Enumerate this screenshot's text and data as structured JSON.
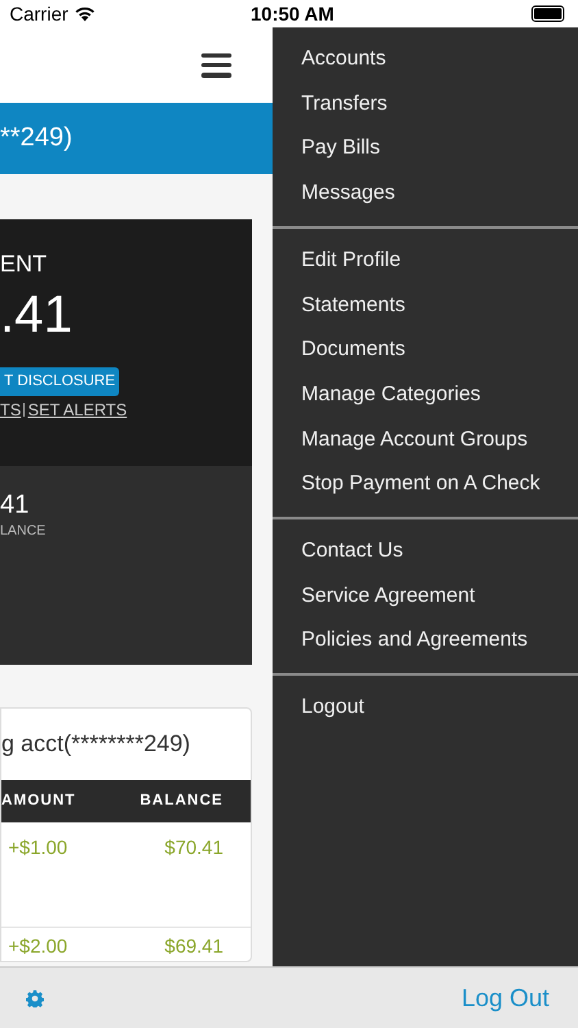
{
  "status_bar": {
    "carrier": "Carrier",
    "time": "10:50 AM"
  },
  "account_bar": {
    "title": "**249)"
  },
  "summary_card": {
    "label": "ENT",
    "amount": ".41",
    "disclosure": "T DISCLOSURE",
    "links": [
      {
        "text": "TS"
      },
      {
        "text": "SET ALERTS"
      }
    ],
    "secondary_amount": "41",
    "secondary_label": "LANCE"
  },
  "activity_card": {
    "title": "g acct(********249)",
    "columns": [
      "AMOUNT",
      "BALANCE"
    ],
    "rows": [
      [
        "+$1.00",
        "$70.41"
      ],
      [
        "+$2.00",
        "$69.41"
      ]
    ]
  },
  "menu": {
    "groups": [
      [
        "Accounts",
        "Transfers",
        "Pay Bills",
        "Messages"
      ],
      [
        "Edit Profile",
        "Statements",
        "Documents",
        "Manage Categories",
        "Manage Account Groups",
        "Stop Payment on A Check"
      ],
      [
        "Contact Us",
        "Service Agreement",
        "Policies and Agreements"
      ],
      [
        "Logout"
      ]
    ]
  },
  "bottom_bar": {
    "logout": "Log Out"
  }
}
